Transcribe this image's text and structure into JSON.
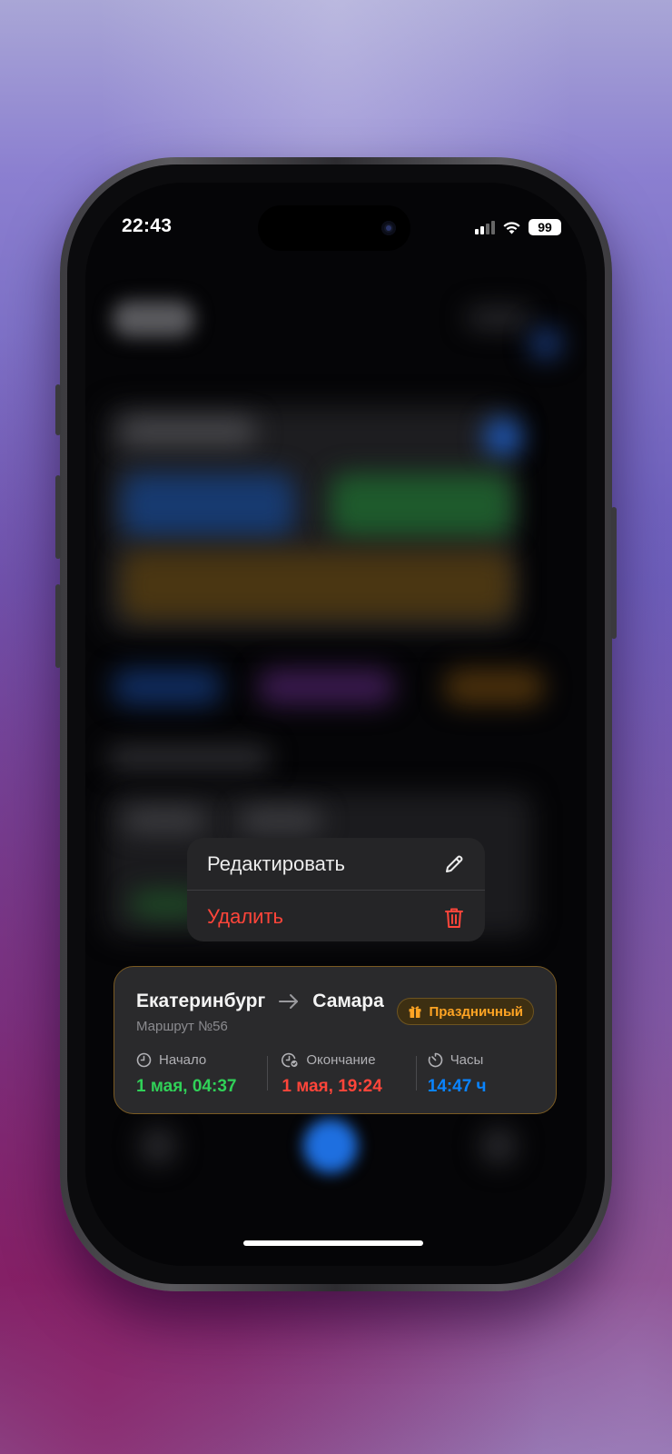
{
  "status_bar": {
    "time": "22:43",
    "battery": "99"
  },
  "context_menu": {
    "items": [
      {
        "label": "Редактировать",
        "icon": "pencil-icon",
        "style": "default"
      },
      {
        "label": "Удалить",
        "icon": "trash-icon",
        "style": "destructive"
      }
    ]
  },
  "route_card": {
    "from": "Екатеринбург",
    "to": "Самара",
    "route_number": "Маршрут №56",
    "badge": "Праздничный",
    "stats": [
      {
        "label": "Начало",
        "value": "1 мая, 04:37",
        "icon": "clock-icon",
        "color": "#30d158"
      },
      {
        "label": "Окончание",
        "value": "1 мая, 19:24",
        "icon": "clock-check-icon",
        "color": "#ff453a"
      },
      {
        "label": "Часы",
        "value": "14:47 ч",
        "icon": "timer-icon",
        "color": "#0a84ff"
      }
    ]
  },
  "colors": {
    "accent_orange": "#ffa424",
    "destructive": "#ff453a",
    "card_border": "#7a5a22"
  }
}
